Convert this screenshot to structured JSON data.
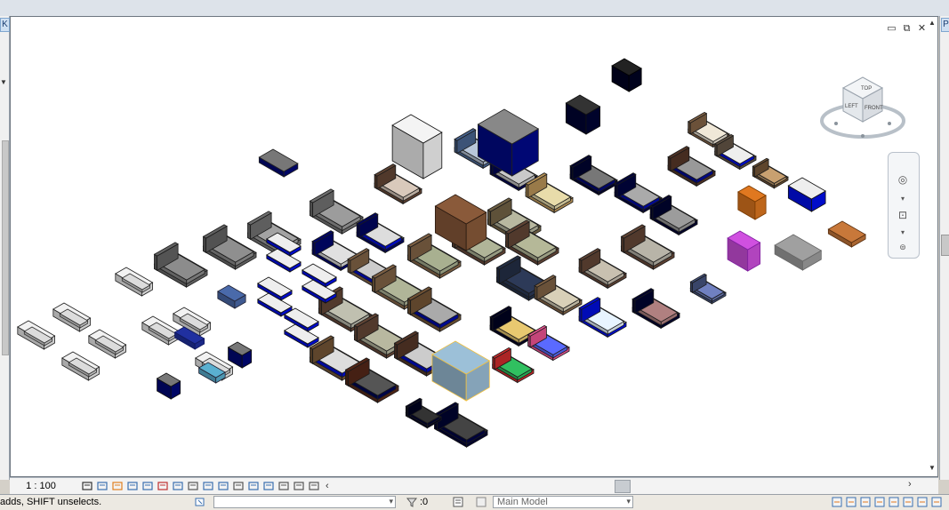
{
  "left_panel": {
    "tab_label": "K"
  },
  "right_panel": {
    "tab_label": "P"
  },
  "viewport": {
    "window_controls": {
      "minimize": "▭",
      "restore": "⧉",
      "close": "✕"
    },
    "viewcube": {
      "top_label": "TOP",
      "front_label": "FRONT",
      "left_label": "LEFT"
    }
  },
  "view_control_bar": {
    "scale": "1 : 100",
    "icons": [
      "detail-level-icon",
      "visual-style-icon",
      "sun-path-icon",
      "shadows-icon",
      "render-icon",
      "crop-view-icon",
      "show-crop-icon",
      "lock-view-icon",
      "temp-hide-icon",
      "reveal-hidden-icon",
      "analysis-icon",
      "highlight-icon",
      "constraints-icon",
      "worksharing-icon",
      "design-options-icon",
      "hide-analytical-icon"
    ]
  },
  "status_bar": {
    "message": "adds, SHIFT unselects.",
    "select_count": ":0",
    "model_selector": "Main Model"
  },
  "colors": {
    "viewport_bg": "#ffffff",
    "chrome": "#d4d0c8",
    "selected": "#f0c040",
    "accent": "#3a6fb0"
  }
}
